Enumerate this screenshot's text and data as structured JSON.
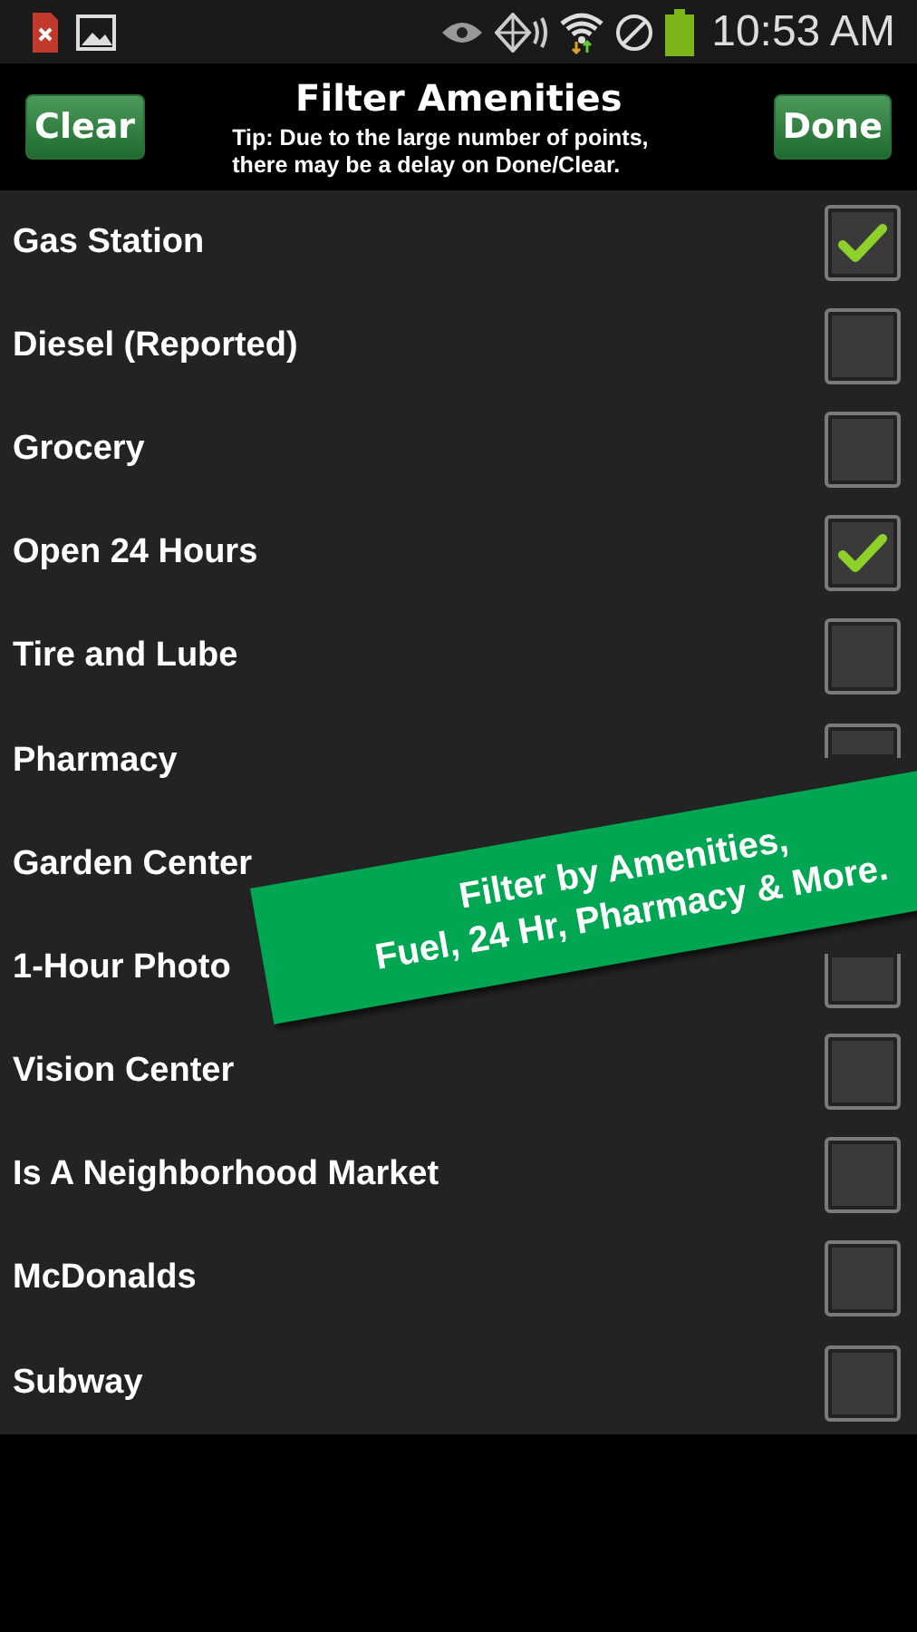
{
  "status_bar": {
    "time": "10:53 AM"
  },
  "header": {
    "title": "Filter Amenities",
    "tip": "Tip: Due to the large number of points, there may be a delay on Done/Clear.",
    "left_button": "Clear",
    "right_button": "Done"
  },
  "amenities": [
    {
      "label": "Gas Station",
      "checked": true
    },
    {
      "label": "Diesel (Reported)",
      "checked": false
    },
    {
      "label": "Grocery",
      "checked": false
    },
    {
      "label": "Open 24 Hours",
      "checked": true
    },
    {
      "label": "Tire and Lube",
      "checked": false
    },
    {
      "label": "Pharmacy",
      "checked": false,
      "kind": "top"
    },
    {
      "label": "Garden Center",
      "kind": "hidden"
    },
    {
      "label": "1-Hour Photo",
      "checked": false,
      "kind": "bottom"
    },
    {
      "label": "Vision Center",
      "checked": false
    },
    {
      "label": "Is A Neighborhood Market",
      "checked": false
    },
    {
      "label": "McDonalds",
      "checked": false
    },
    {
      "label": "Subway",
      "checked": false
    }
  ],
  "banner": {
    "lines": [
      "Filter by Amenities,",
      "Fuel, 24 Hr, Pharmacy & More."
    ]
  }
}
